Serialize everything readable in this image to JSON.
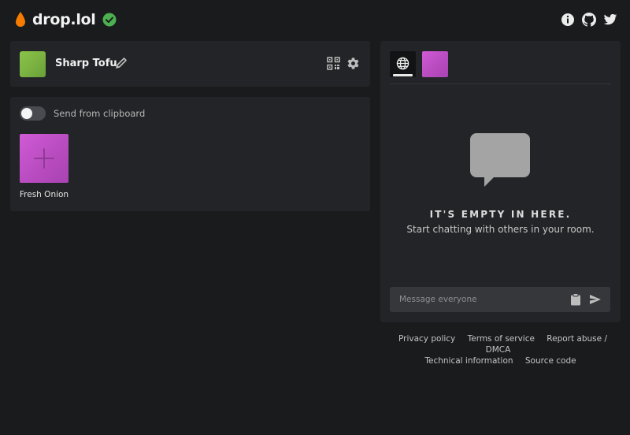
{
  "app": {
    "title": "drop.lol"
  },
  "header": {
    "icons": [
      "info-icon",
      "github-icon",
      "twitter-icon"
    ]
  },
  "profile": {
    "name": "Sharp Tofu",
    "avatar_color": "#8bc34a"
  },
  "transfer": {
    "clipboard_label": "Send from clipboard",
    "clipboard_enabled": false,
    "peers": [
      {
        "name": "Fresh Onion",
        "color": "#c04fc6"
      }
    ]
  },
  "chat": {
    "empty_title": "IT'S EMPTY IN HERE.",
    "empty_subtitle": "Start chatting with others in your room.",
    "input_placeholder": "Message everyone"
  },
  "footer": {
    "links_row1": [
      "Privacy policy",
      "Terms of service",
      "Report abuse / DMCA"
    ],
    "links_row2": [
      "Technical information",
      "Source code"
    ]
  },
  "colors": {
    "background": "#1a1b1c",
    "card": "#232427",
    "accent_drop": "#f57c00",
    "verified": "#4caf50"
  }
}
